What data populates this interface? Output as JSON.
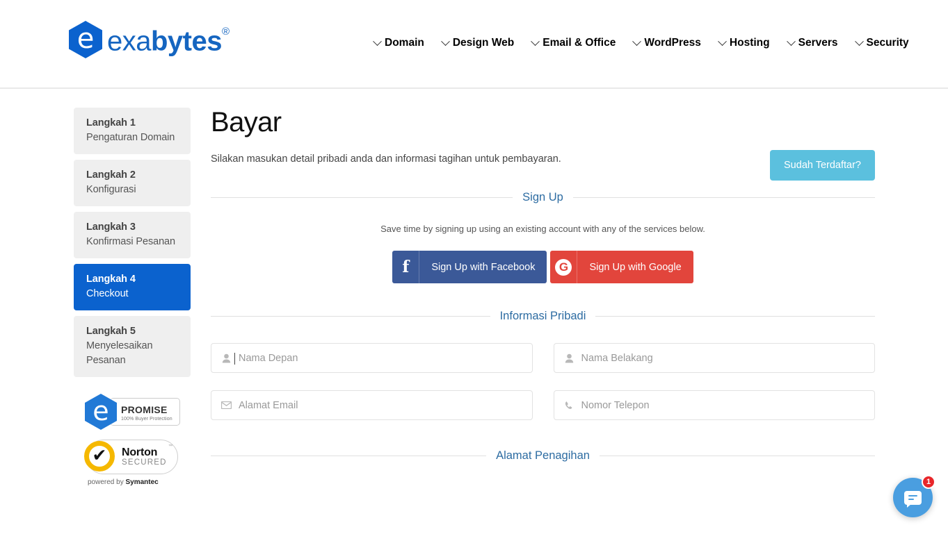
{
  "header": {
    "logo": {
      "prefix": "exa",
      "suffix": "bytes",
      "trademark": "®",
      "mark_letter": "e"
    },
    "nav": [
      {
        "label": "Domain",
        "icon": "chevron-down-icon"
      },
      {
        "label": "Design Web",
        "icon": "chevron-down-icon"
      },
      {
        "label": "Email & Office",
        "icon": "chevron-down-icon"
      },
      {
        "label": "WordPress",
        "icon": "chevron-down-icon"
      },
      {
        "label": "Hosting",
        "icon": "chevron-down-icon"
      },
      {
        "label": "Servers",
        "icon": "chevron-down-icon"
      },
      {
        "label": "Security",
        "icon": "chevron-down-icon"
      }
    ]
  },
  "sidebar": {
    "steps": [
      {
        "title": "Langkah 1",
        "sub": "Pengaturan Domain",
        "active": false
      },
      {
        "title": "Langkah 2",
        "sub": "Konfigurasi",
        "active": false
      },
      {
        "title": "Langkah 3",
        "sub": "Konfirmasi Pesanan",
        "active": false
      },
      {
        "title": "Langkah 4",
        "sub": "Checkout",
        "active": true
      },
      {
        "title": "Langkah 5",
        "sub": "Menyelesaikan Pesanan",
        "active": false
      }
    ],
    "badges": {
      "promise": {
        "mark_letter": "e",
        "title": "PROMISE",
        "subtitle": "100% Buyer Protection"
      },
      "norton": {
        "name": "Norton",
        "secured": "SECURED",
        "tm": "™",
        "footer_prefix": "powered by ",
        "footer_brand": "Symantec",
        "check": "✔"
      }
    }
  },
  "main": {
    "title": "Bayar",
    "subtitle": "Silakan masukan detail pribadi anda dan informasi tagihan untuk pembayaran.",
    "registered_button": "Sudah Terdaftar?",
    "signup_section": {
      "heading": "Sign Up",
      "description": "Save time by signing up using an existing account with any of the services below.",
      "facebook_button": {
        "label": "Sign Up with Facebook",
        "icon": "facebook-icon",
        "glyph": "f"
      },
      "google_button": {
        "label": "Sign Up with Google",
        "icon": "google-icon",
        "glyph": "G"
      }
    },
    "personal_section": {
      "heading": "Informasi Pribadi",
      "fields": [
        {
          "placeholder": "Nama Depan",
          "icon": "user-icon",
          "value": "",
          "focused": true
        },
        {
          "placeholder": "Nama Belakang",
          "icon": "user-icon",
          "value": "",
          "focused": false
        },
        {
          "placeholder": "Alamat Email",
          "icon": "envelope-icon",
          "value": "",
          "focused": false
        },
        {
          "placeholder": "Nomor Telepon",
          "icon": "phone-icon",
          "value": "",
          "focused": false
        }
      ]
    },
    "billing_section": {
      "heading": "Alamat Penagihan"
    }
  },
  "chat_widget": {
    "icon": "chat-bubble-icon",
    "badge_count": "1"
  },
  "colors": {
    "brand_blue": "#0b62ce",
    "logo_blue": "#1565c0",
    "accent_cyan": "#5bc0de",
    "facebook": "#3b5998",
    "google": "#e2453c",
    "section_heading": "#2d6ca2",
    "step_inactive_bg": "#efefef",
    "chat_blue": "#4a9ee0",
    "badge_red": "#e8262a",
    "norton_gold": "#f5b800"
  }
}
